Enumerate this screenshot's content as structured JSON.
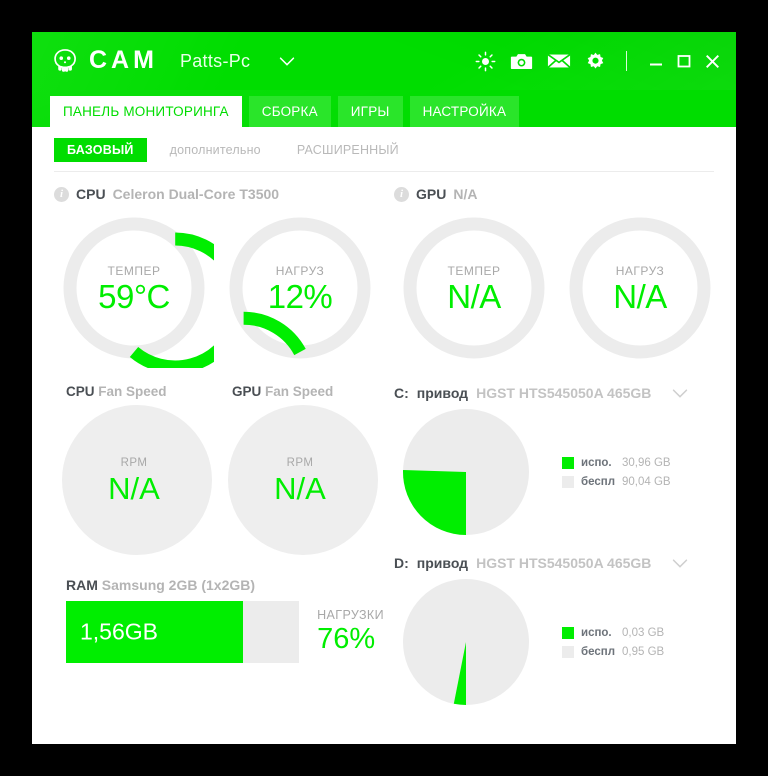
{
  "window": {
    "app_name": "CAM",
    "pc_name": "Patts-Pc",
    "logo_icon": "skull-icon",
    "dropdown_icon": "chevron-down-icon",
    "titlebar_icons": [
      "brightness-icon",
      "camera-icon",
      "mail-icon",
      "gear-icon"
    ],
    "controls": [
      "minimize-button",
      "maximize-button",
      "close-button"
    ],
    "accent_color": "#00dd00",
    "value_color": "#00ee00",
    "track_color": "#ececec"
  },
  "tabs": [
    {
      "label": "ПАНЕЛЬ МОНИТОРИНГА",
      "active": true
    },
    {
      "label": "СБОРКА",
      "active": false
    },
    {
      "label": "ИГРЫ",
      "active": false
    },
    {
      "label": "НАСТРОЙКА",
      "active": false
    }
  ],
  "subtabs": [
    {
      "label": "БАЗОВЫЙ",
      "active": true
    },
    {
      "label": "дополнительно",
      "active": false
    },
    {
      "label": "РАСШИРЕННЫЙ",
      "active": false
    }
  ],
  "cpu": {
    "key": "CPU",
    "model": "Celeron Dual-Core T3500",
    "temp": {
      "label": "ТЕМПЕР",
      "value": "59°C",
      "percent": 70
    },
    "load": {
      "label": "НАГРУЗ",
      "value": "12%",
      "percent": 12
    }
  },
  "gpu": {
    "key": "GPU",
    "model": "N/A",
    "temp": {
      "label": "ТЕМПЕР",
      "value": "N/A",
      "percent": 0
    },
    "load": {
      "label": "НАГРУЗ",
      "value": "N/A",
      "percent": 0
    }
  },
  "fans": {
    "cpu": {
      "key": "CPU",
      "title": "Fan Speed",
      "label": "RPM",
      "value": "N/A"
    },
    "gpu": {
      "key": "GPU",
      "title": "Fan Speed",
      "label": "RPM",
      "value": "N/A"
    }
  },
  "ram": {
    "key": "RAM",
    "model": "Samsung 2GB (1x2GB)",
    "amount": "1,56GB",
    "load_label": "НАГРУЗКИ",
    "load_value": "76%",
    "percent": 76
  },
  "drives": [
    {
      "letter": "C:",
      "kind": "привод",
      "model": "HGST HTS545050A 465GB",
      "chevron": "chevron-down-icon",
      "used_label": "испо.",
      "used_value": "30,96 GB",
      "free_label": "беспл",
      "free_value": "90,04 GB",
      "used_percent": 25.5
    },
    {
      "letter": "D:",
      "kind": "привод",
      "model": "HGST HTS545050A 465GB",
      "chevron": "chevron-down-icon",
      "used_label": "испо.",
      "used_value": "0,03 GB",
      "free_label": "беспл",
      "free_value": "0,95 GB",
      "used_percent": 3.1
    }
  ],
  "chart_data": [
    {
      "type": "pie",
      "title": "C: привод HGST HTS545050A 465GB",
      "labels": [
        "испо.",
        "беспл"
      ],
      "values": [
        30.96,
        90.04
      ],
      "unit": "GB",
      "colors": [
        "#00ee00",
        "#ececec"
      ],
      "legend": "right"
    },
    {
      "type": "pie",
      "title": "D: привод HGST HTS545050A 465GB",
      "labels": [
        "испо.",
        "беспл"
      ],
      "values": [
        0.03,
        0.95
      ],
      "unit": "GB",
      "colors": [
        "#00ee00",
        "#ececec"
      ],
      "legend": "right"
    },
    {
      "type": "bar",
      "title": "RAM Samsung 2GB (1x2GB)",
      "categories": [
        "НАГРУЗКИ"
      ],
      "values": [
        76
      ],
      "value_label": "1,56GB",
      "ylim": [
        0,
        100
      ],
      "unit": "%"
    }
  ]
}
